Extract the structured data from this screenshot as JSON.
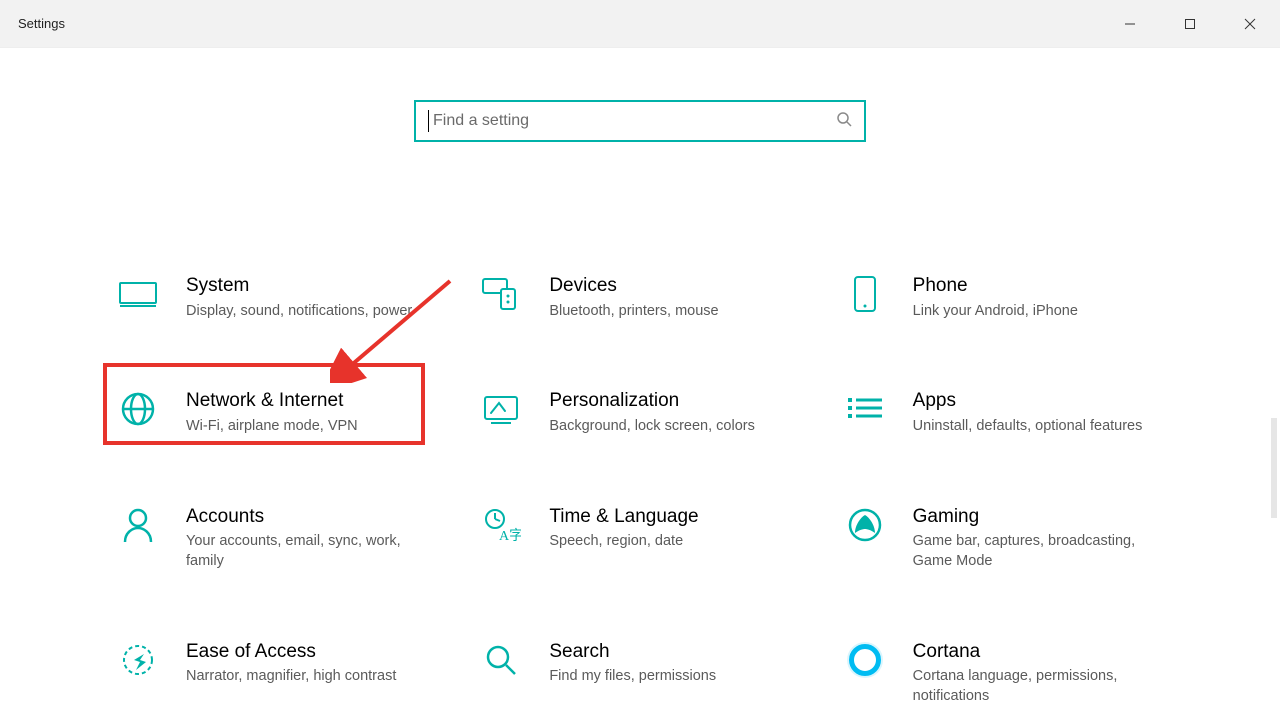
{
  "window": {
    "title": "Settings"
  },
  "search": {
    "placeholder": "Find a setting",
    "value": ""
  },
  "tiles": [
    {
      "id": "system",
      "title": "System",
      "sub": "Display, sound, notifications, power"
    },
    {
      "id": "devices",
      "title": "Devices",
      "sub": "Bluetooth, printers, mouse"
    },
    {
      "id": "phone",
      "title": "Phone",
      "sub": "Link your Android, iPhone"
    },
    {
      "id": "network",
      "title": "Network & Internet",
      "sub": "Wi-Fi, airplane mode, VPN"
    },
    {
      "id": "personalization",
      "title": "Personalization",
      "sub": "Background, lock screen, colors"
    },
    {
      "id": "apps",
      "title": "Apps",
      "sub": "Uninstall, defaults, optional features"
    },
    {
      "id": "accounts",
      "title": "Accounts",
      "sub": "Your accounts, email, sync, work, family"
    },
    {
      "id": "time",
      "title": "Time & Language",
      "sub": "Speech, region, date"
    },
    {
      "id": "gaming",
      "title": "Gaming",
      "sub": "Game bar, captures, broadcasting, Game Mode"
    },
    {
      "id": "ease",
      "title": "Ease of Access",
      "sub": "Narrator, magnifier, high contrast"
    },
    {
      "id": "search",
      "title": "Search",
      "sub": "Find my files, permissions"
    },
    {
      "id": "cortana",
      "title": "Cortana",
      "sub": "Cortana language, permissions, notifications"
    }
  ],
  "annotation": {
    "highlighted_tile": "network"
  },
  "colors": {
    "accent": "#00b2a9",
    "annotation": "#e7332b"
  }
}
